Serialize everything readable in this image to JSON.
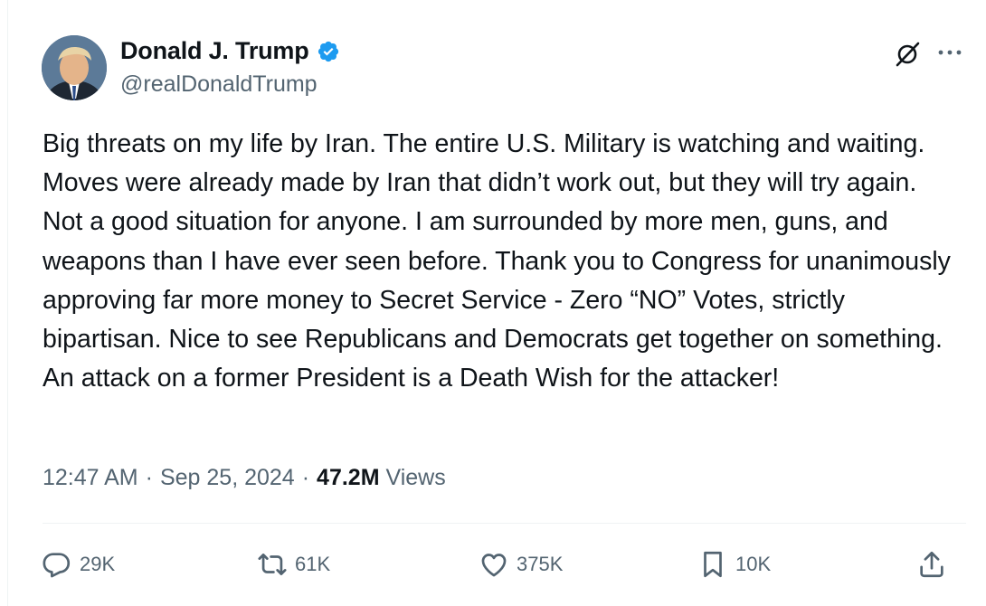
{
  "author": {
    "display_name": "Donald J. Trump",
    "handle": "@realDonaldTrump",
    "verified_icon": "verified-badge-icon",
    "avatar": "avatar-photo"
  },
  "header_icons": [
    "grok-icon",
    "more-icon"
  ],
  "tweet": {
    "text": "Big threats on my life by Iran. The entire U.S. Military is watching and waiting. Moves were already made by Iran that didn’t work out, but they will try again. Not a good situation for anyone. I am surrounded by more men, guns, and weapons than I have ever seen before. Thank you to Congress for unanimously approving far more money to Secret Service - Zero “NO” Votes, strictly bipartisan. Nice to see Republicans and Democrats get together on something. An attack on a former President is a Death Wish for the attacker!"
  },
  "meta": {
    "time": "12:47 AM",
    "separator_1": "·",
    "date": "Sep 25, 2024",
    "separator_2": "·",
    "views_count": "47.2M",
    "views_label": "Views"
  },
  "actions": {
    "reply": {
      "icon": "reply-icon",
      "count": "29K"
    },
    "repost": {
      "icon": "repost-icon",
      "count": "61K"
    },
    "like": {
      "icon": "like-icon",
      "count": "375K"
    },
    "bookmark": {
      "icon": "bookmark-icon",
      "count": "10K"
    },
    "share": {
      "icon": "share-icon"
    }
  },
  "colors": {
    "text_primary": "#0f1419",
    "text_secondary": "#536471",
    "verified_blue": "#1d9bf0",
    "divider": "#eff3f4"
  }
}
